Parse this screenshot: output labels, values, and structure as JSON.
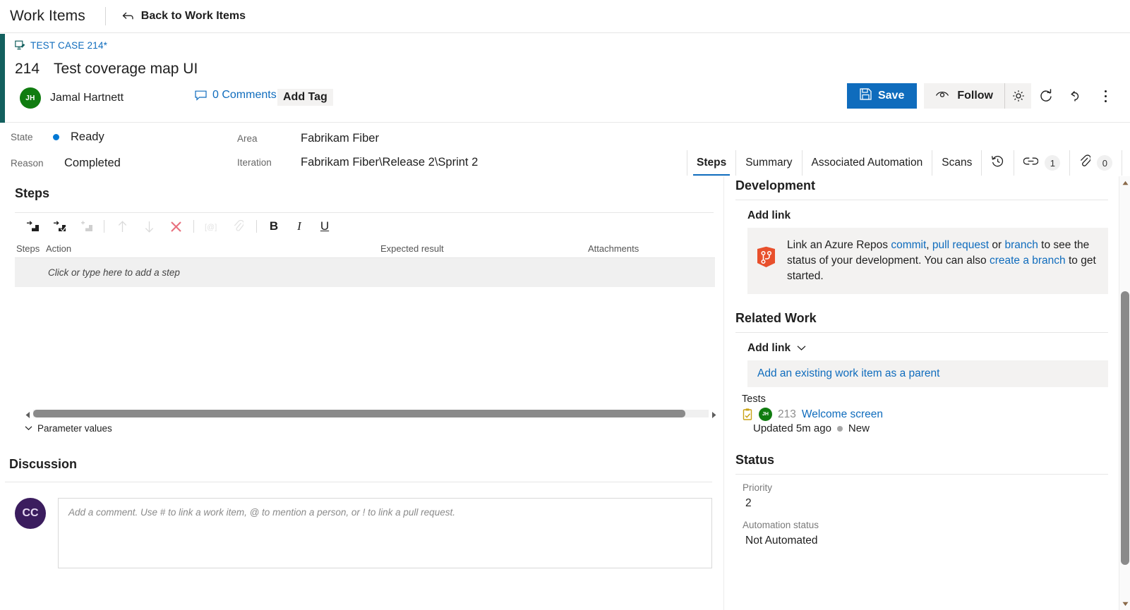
{
  "hub": {
    "title": "Work Items",
    "back_label": "Back to Work Items",
    "back_icon": "back-arrow-icon"
  },
  "work_item": {
    "type_line": "TEST CASE 214*",
    "type_icon": "test-case-icon",
    "id": "214",
    "title": "Test coverage map UI",
    "assignee": "Jamal Hartnett",
    "assignee_initials": "JH",
    "comments_label": "0 Comments",
    "add_tag_label": "Add Tag",
    "accent_color": "#13605e"
  },
  "toolbar": {
    "save_label": "Save",
    "save_icon": "save-disk-icon",
    "follow_label": "Follow",
    "follow_icon": "eye-icon",
    "gear_icon": "gear-icon",
    "refresh_icon": "refresh-icon",
    "revert_icon": "undo-icon",
    "more_icon": "more-vertical-icon"
  },
  "fields": {
    "state_label": "State",
    "state_value": "Ready",
    "state_color": "#0078d4",
    "reason_label": "Reason",
    "reason_value": "Completed",
    "area_label": "Area",
    "area_value": "Fabrikam Fiber",
    "iteration_label": "Iteration",
    "iteration_value": "Fabrikam Fiber\\Release 2\\Sprint 2"
  },
  "tabs": [
    {
      "label": "Steps",
      "active": true
    },
    {
      "label": "Summary",
      "active": false
    },
    {
      "label": "Associated Automation",
      "active": false
    },
    {
      "label": "Scans",
      "active": false
    }
  ],
  "tab_icons": [
    {
      "name": "history-icon",
      "count": null
    },
    {
      "name": "link-icon",
      "count": "1"
    },
    {
      "name": "attachment-icon",
      "count": "0"
    }
  ],
  "steps_section": {
    "heading": "Steps",
    "toolbar_buttons": [
      {
        "name": "insert-step-icon",
        "disabled": false
      },
      {
        "name": "insert-shared-step-icon",
        "disabled": false
      },
      {
        "name": "add-shared-step-icon",
        "disabled": true
      },
      {
        "name": "move-up-icon",
        "disabled": true
      },
      {
        "name": "move-down-icon",
        "disabled": true
      },
      {
        "name": "delete-step-icon",
        "disabled": false
      },
      {
        "name": "mention-icon",
        "disabled": true
      },
      {
        "name": "attach-icon",
        "disabled": true
      }
    ],
    "format_bold": "B",
    "format_italic": "I",
    "format_underline": "U",
    "columns": [
      "Steps",
      "Action",
      "Expected result",
      "Attachments"
    ],
    "empty_row_text": "Click or type here to add a step",
    "parameter_values_label": "Parameter values"
  },
  "discussion": {
    "heading": "Discussion",
    "avatar_initials": "CC",
    "placeholder": "Add a comment. Use # to link a work item, @ to mention a person, or ! to link a pull request."
  },
  "development": {
    "heading": "Development",
    "add_link_label": "Add link",
    "icon": "azure-repos-icon",
    "text_1": "Link an Azure Repos ",
    "link_commit": "commit",
    "text_2": ", ",
    "link_pull_request": "pull request",
    "text_3": " or ",
    "link_branch": "branch",
    "text_4": " to see the status of your development. You can also ",
    "link_create_branch": "create a branch",
    "text_5": " to get started."
  },
  "related_work": {
    "heading": "Related Work",
    "add_link_label": "Add link",
    "chevron_icon": "chevron-down-icon",
    "add_parent_label": "Add an existing work item as a parent",
    "group_label": "Tests",
    "item": {
      "icon": "test-case-small-icon",
      "avatar_initials": "JH",
      "id": "213",
      "title": "Welcome screen",
      "updated": "Updated 5m ago",
      "state": "New"
    }
  },
  "status": {
    "heading": "Status",
    "priority_label": "Priority",
    "priority_value": "2",
    "automation_label": "Automation status",
    "automation_value": "Not Automated"
  }
}
